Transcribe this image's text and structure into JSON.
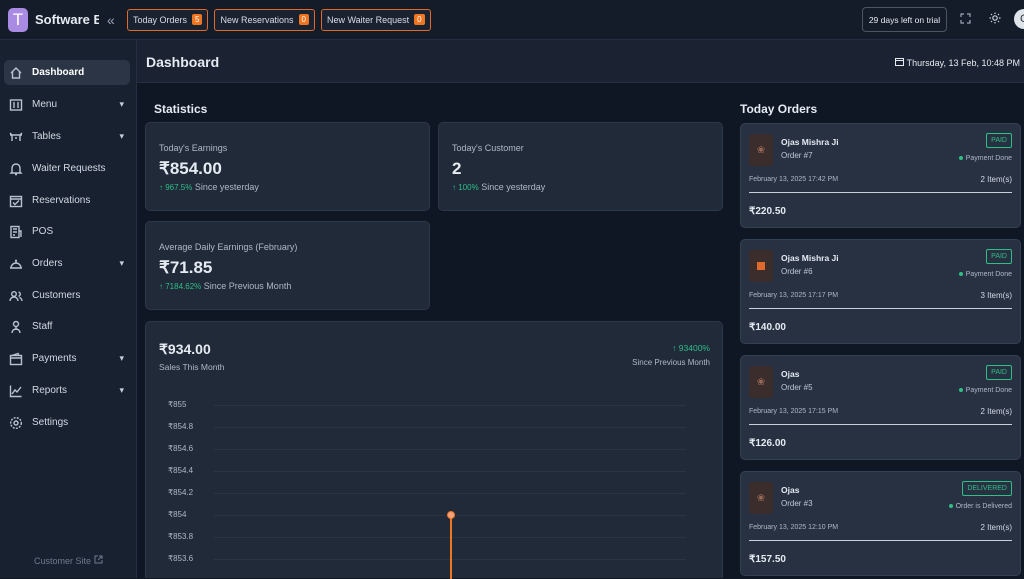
{
  "topbar": {
    "logo_letter": "T",
    "app_name": "Software B...",
    "collapse_icon": "«",
    "buttons": [
      {
        "label": "Today Orders",
        "count": "5"
      },
      {
        "label": "New Reservations",
        "count": "0"
      },
      {
        "label": "New Waiter Request",
        "count": "0"
      }
    ],
    "trial": "29 days left on trial",
    "avatar": "C"
  },
  "sidebar": {
    "items": [
      {
        "label": "Dashboard",
        "icon": "home-icon"
      },
      {
        "label": "Menu",
        "icon": "menu-icon",
        "chevron": "▾"
      },
      {
        "label": "Tables",
        "icon": "table-icon",
        "chevron": "▾"
      },
      {
        "label": "Waiter Requests",
        "icon": "bell-icon"
      },
      {
        "label": "Reservations",
        "icon": "calendar-check-icon"
      },
      {
        "label": "POS",
        "icon": "pos-icon"
      },
      {
        "label": "Orders",
        "icon": "orders-icon",
        "chevron": "▾"
      },
      {
        "label": "Customers",
        "icon": "users-icon"
      },
      {
        "label": "Staff",
        "icon": "staff-icon"
      },
      {
        "label": "Payments",
        "icon": "wallet-icon",
        "chevron": "▾"
      },
      {
        "label": "Reports",
        "icon": "chart-icon",
        "chevron": "▾"
      },
      {
        "label": "Settings",
        "icon": "gear-icon"
      }
    ],
    "customer_site": "Customer Site"
  },
  "header": {
    "title": "Dashboard",
    "datetime": "Thursday, 13 Feb, 10:48 PM"
  },
  "statistics": {
    "title": "Statistics",
    "earnings": {
      "label": "Today's Earnings",
      "value": "₹854.00",
      "change": "967.5%",
      "since": "Since yesterday"
    },
    "customers": {
      "label": "Today's Customer",
      "value": "2",
      "change": "100%",
      "since": "Since yesterday"
    },
    "avg": {
      "label": "Average Daily Earnings (February)",
      "value": "₹71.85",
      "change": "7184.62%",
      "since": "Since Previous Month"
    }
  },
  "sales": {
    "value": "₹934.00",
    "label": "Sales This Month",
    "change": "93400%",
    "since": "Since Previous Month"
  },
  "chart_data": {
    "type": "line",
    "y_ticks": [
      "₹855",
      "₹854.8",
      "₹854.6",
      "₹854.4",
      "₹854.2",
      "₹854",
      "₹853.8",
      "₹853.6"
    ],
    "ylim": [
      853.6,
      855
    ],
    "points": [
      {
        "y": 854
      }
    ],
    "line_color": "#f07520"
  },
  "today_orders": {
    "title": "Today Orders",
    "orders": [
      {
        "name": "Ojas Mishra Ji",
        "number": "Order #7",
        "status": "PAID",
        "payment": "Payment Done",
        "date": "February 13, 2025 17:42 PM",
        "items": "2 Item(s)",
        "amount": "₹220.50",
        "thumb": "food-icon"
      },
      {
        "name": "Ojas Mishra Ji",
        "number": "Order #6",
        "status": "PAID",
        "payment": "Payment Done",
        "date": "February 13, 2025 17:17 PM",
        "items": "3 Item(s)",
        "amount": "₹140.00",
        "thumb": "food-icon"
      },
      {
        "name": "Ojas",
        "number": "Order #5",
        "status": "PAID",
        "payment": "Payment Done",
        "date": "February 13, 2025 17:15 PM",
        "items": "2 Item(s)",
        "amount": "₹126.00",
        "thumb": "food-icon"
      },
      {
        "name": "Ojas",
        "number": "Order #3",
        "status": "DELIVERED",
        "payment": "Order is Delivered",
        "date": "February 13, 2025 12:10 PM",
        "items": "2 Item(s)",
        "amount": "₹157.50",
        "thumb": "food-icon"
      }
    ]
  }
}
